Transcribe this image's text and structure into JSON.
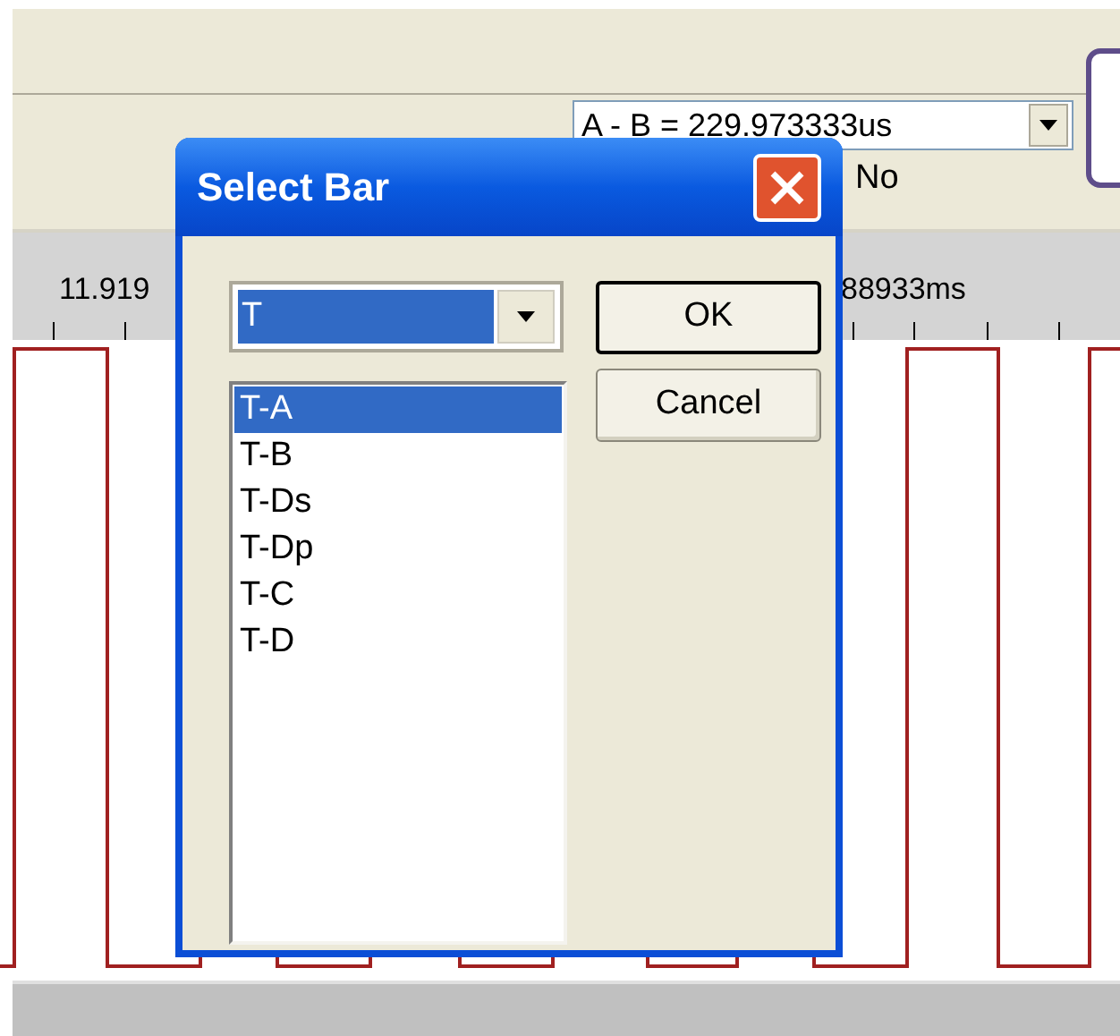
{
  "app": {
    "measure_select": {
      "value": "A - B = 229.973333us"
    },
    "label": "No",
    "ruler_labels": [
      "11.919",
      "88933ms"
    ]
  },
  "dialog": {
    "title": "Select Bar",
    "combo": {
      "value": "T"
    },
    "list": [
      {
        "label": "T-A",
        "selected": true
      },
      {
        "label": "T-B",
        "selected": false
      },
      {
        "label": "T-Ds",
        "selected": false
      },
      {
        "label": "T-Dp",
        "selected": false
      },
      {
        "label": "T-C",
        "selected": false
      },
      {
        "label": "T-D",
        "selected": false
      }
    ],
    "buttons": [
      {
        "label": "OK",
        "default": true
      },
      {
        "label": "Cancel",
        "default": false
      }
    ]
  }
}
